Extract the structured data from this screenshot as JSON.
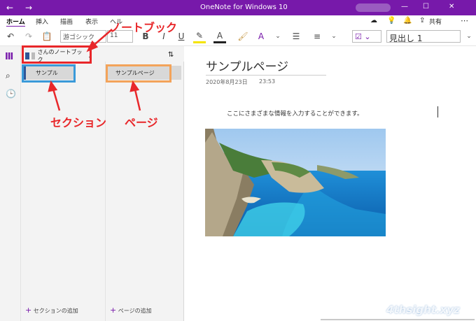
{
  "window": {
    "title": "OneNote for Windows 10",
    "back_icon": "←",
    "forward_icon": "→",
    "account": "",
    "min": "—",
    "max": "☐",
    "close": "✕"
  },
  "ribbon": {
    "tabs": [
      "ホーム",
      "挿入",
      "描画",
      "表示",
      "ヘル"
    ],
    "share_label": "共有",
    "more": "⋯"
  },
  "toolbar": {
    "font_name": "游ゴシック",
    "font_size": "11",
    "bold": "B",
    "italic": "I",
    "underline": "U",
    "font_color": "A",
    "style": "見出し 1"
  },
  "notebook": {
    "name": "さんのノートブック"
  },
  "sections": [
    {
      "label": "サンプル"
    }
  ],
  "pages": [
    {
      "label": "サンプルページ"
    }
  ],
  "add_section": "セクションの追加",
  "add_page": "ページの追加",
  "page": {
    "title": "サンプルページ",
    "date": "2020年8月23日",
    "time": "23:53",
    "body": "ここにさまざまな情報を入力することができます。"
  },
  "annotations": {
    "notebook": "ノートブック",
    "section": "セクション",
    "page": "ページ"
  },
  "watermark": "4thsight.xyz",
  "colors": {
    "accent": "#7719aa",
    "annotation_red": "#e8272a",
    "section_blue": "#3a9ad9",
    "page_orange": "#f3a35a"
  }
}
